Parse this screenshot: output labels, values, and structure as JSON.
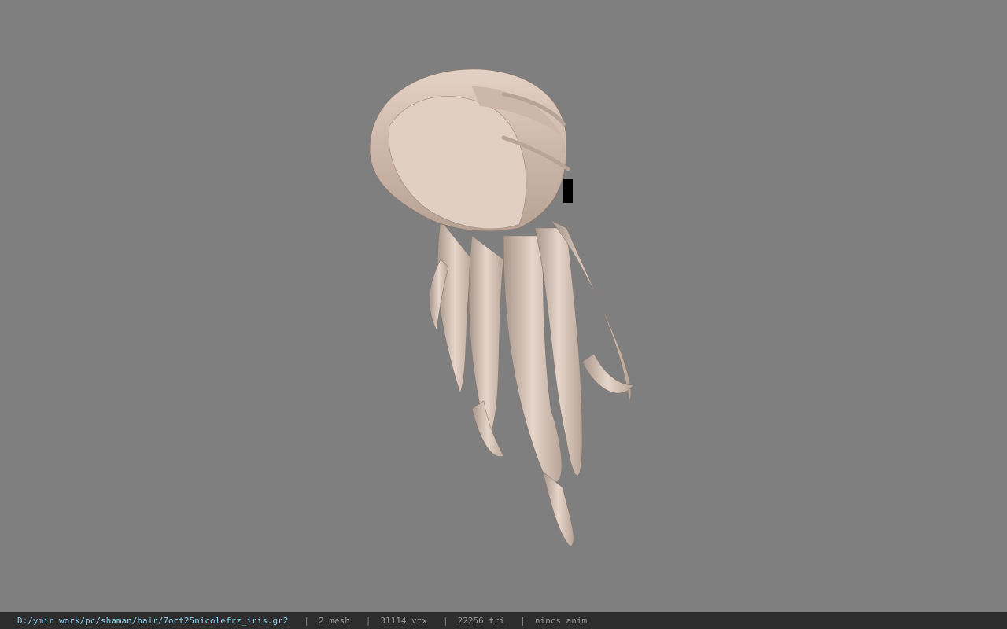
{
  "viewport": {
    "background_color": "#7f7f7f",
    "model_subject": "hair-mesh",
    "hair_color": "#d9c5b8",
    "hair_shadow_color": "#8c7d74"
  },
  "statusbar": {
    "file_path": "D:/ymir work/pc/shaman/hair/7oct25nicolefrz_iris.gr2",
    "separator": "|",
    "mesh_count": "2 mesh",
    "vertex_count": "31114 vtx",
    "triangle_count": "22256 tri",
    "anim_status": "nincs anim",
    "path_color": "#8fd3f2",
    "background_color": "#2d2d2d"
  }
}
